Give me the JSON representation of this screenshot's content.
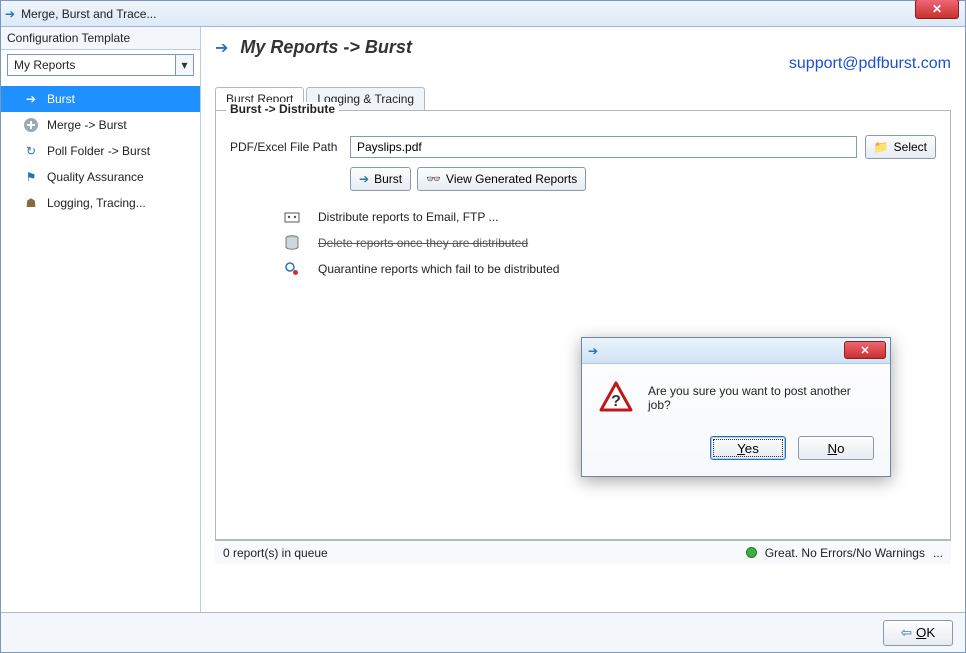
{
  "window": {
    "title": "Merge, Burst and Trace...",
    "close_glyph": "✕"
  },
  "sidebar": {
    "config_label": "Configuration Template",
    "template_selected": "My Reports",
    "items": [
      {
        "label": "Burst"
      },
      {
        "label": "Merge -> Burst"
      },
      {
        "label": "Poll Folder -> Burst"
      },
      {
        "label": "Quality Assurance"
      },
      {
        "label": "Logging, Tracing..."
      }
    ]
  },
  "header": {
    "breadcrumb": "My Reports -> Burst",
    "support_link": "support@pdfburst.com"
  },
  "tabs": {
    "burst_report": "Burst Report",
    "logging_tracing": "Logging & Tracing"
  },
  "form": {
    "group_legend": "Burst -> Distribute",
    "file_label": "PDF/Excel File Path",
    "file_value": "Payslips.pdf",
    "select_btn": "Select",
    "burst_btn": "Burst",
    "view_btn": "View Generated Reports",
    "info_distribute": "Distribute reports to Email, FTP ...",
    "info_delete": "Delete reports once they are distributed",
    "info_quarantine": "Quarantine reports which fail to be distributed"
  },
  "dialog": {
    "message": "Are you sure you want to post another job?",
    "yes": "Yes",
    "no": "No",
    "close_glyph": "✕"
  },
  "status": {
    "queue_text": "0 report(s) in queue",
    "health_text": "Great. No Errors/No Warnings",
    "ellipsis": "..."
  },
  "footer": {
    "ok": "OK"
  }
}
